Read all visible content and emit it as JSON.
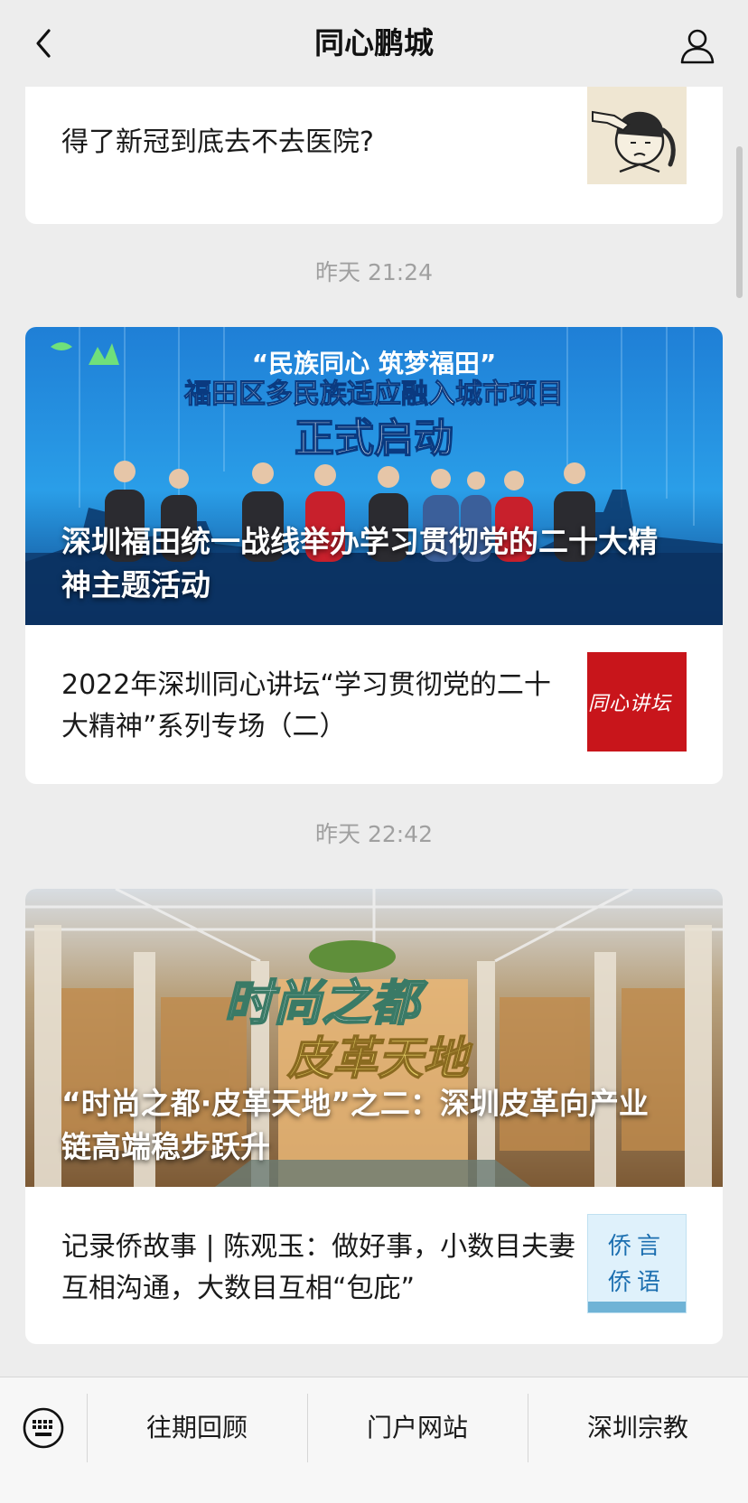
{
  "header": {
    "title": "同心鹏城",
    "back_icon": "chevron-left-icon",
    "profile_icon": "person-icon"
  },
  "feed": [
    {
      "type": "article",
      "items": [
        {
          "title": "得了新冠到底去不去医院?",
          "thumb": "sick-person-illustration"
        }
      ]
    },
    {
      "timestamp": "昨天 21:24",
      "hero": {
        "title": "深圳福田统一战线举办学习贯彻党的二十大精神主题活动",
        "banner_lines": [
          "“民族同心 筑梦福田”",
          "福田区多民族适应融入城市项目",
          "正式启动"
        ]
      },
      "items": [
        {
          "title": "2022年深圳同心讲坛“学习贯彻党的二十大精神”系列专场（二）",
          "thumb_text": "同心讲坛"
        }
      ]
    },
    {
      "timestamp": "昨天 22:42",
      "hero": {
        "title": "“时尚之都·皮革天地”之二：深圳皮革向产业链高端稳步跃升",
        "banner_lines": [
          "时尚之都",
          "皮革天地"
        ]
      },
      "items": [
        {
          "title": "记录侨故事 | 陈观玉：做好事，小数目夫妻互相沟通，大数目互相“包庇”",
          "thumb_text": [
            "侨言",
            "侨语"
          ]
        }
      ]
    }
  ],
  "bottom_menu": {
    "keyboard_icon": "keyboard-icon",
    "items": [
      "往期回顾",
      "门户网站",
      "深圳宗教"
    ]
  },
  "colors": {
    "background": "#ededed",
    "card": "#ffffff",
    "timestamp": "#a0a0a0",
    "red_thumb": "#c8151b"
  }
}
